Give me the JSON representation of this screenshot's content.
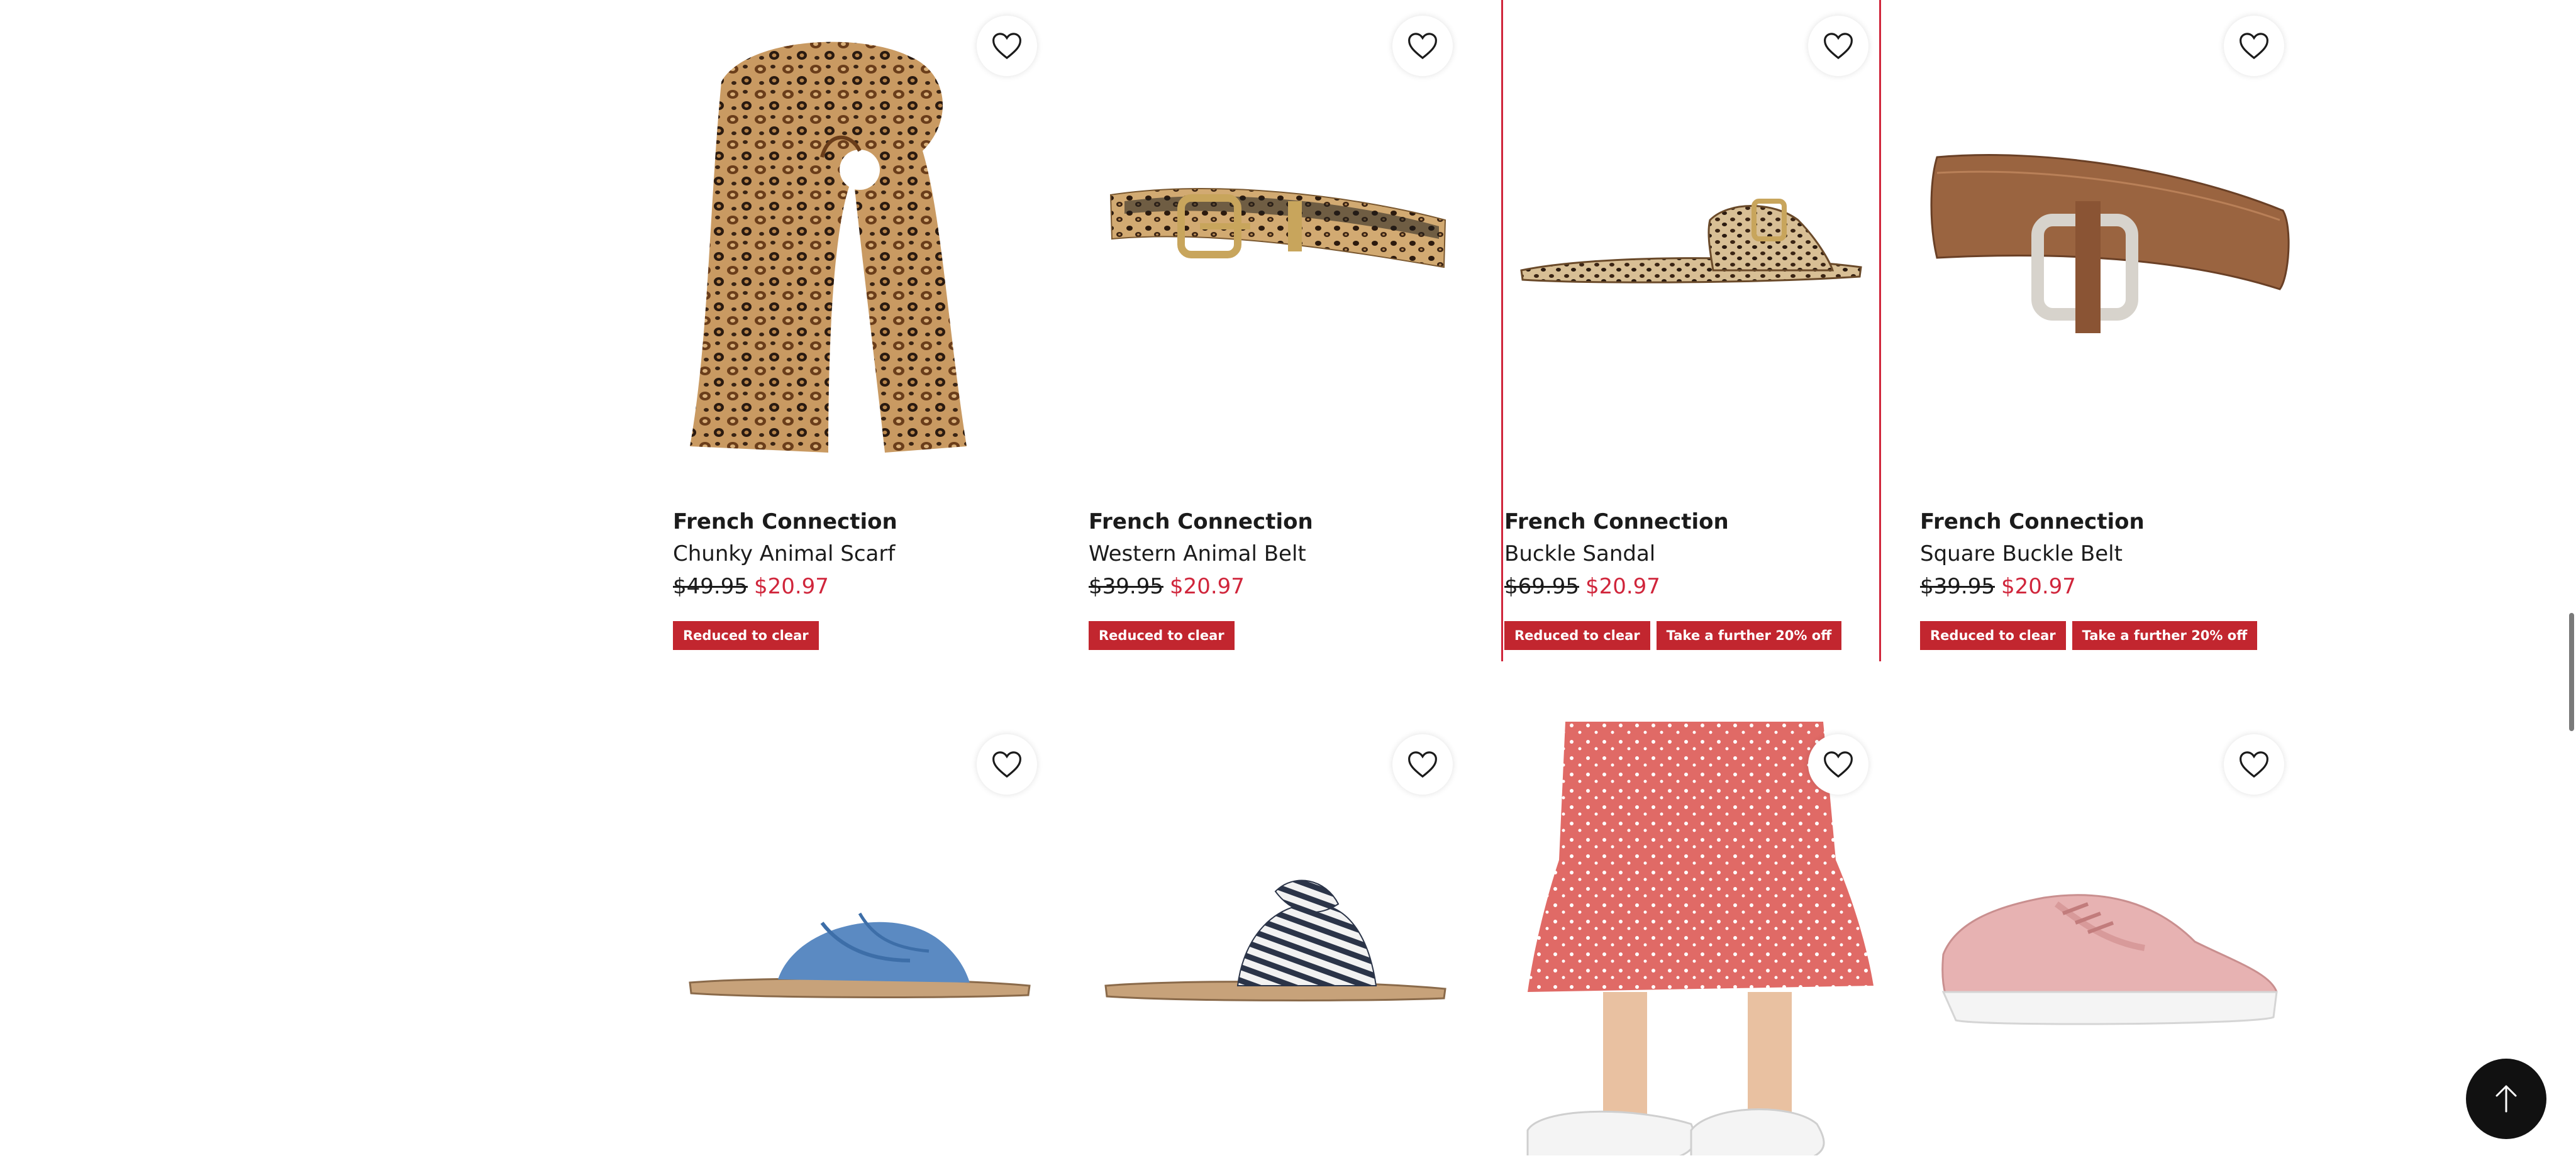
{
  "accent_color": "#d0253b",
  "badge_color": "#c2262f",
  "favorite_icon": "heart-outline-icon",
  "back_to_top_icon": "arrow-up-icon",
  "products": [
    {
      "brand": "French Connection",
      "name": "Chunky Animal Scarf",
      "was_price": "$49.95",
      "now_price": "$20.97",
      "badges": [
        "Reduced to clear"
      ],
      "image": "leopard-print-scarf"
    },
    {
      "brand": "French Connection",
      "name": "Western Animal Belt",
      "was_price": "$39.95",
      "now_price": "$20.97",
      "badges": [
        "Reduced to clear"
      ],
      "image": "leopard-print-belt"
    },
    {
      "brand": "French Connection",
      "name": "Buckle Sandal",
      "was_price": "$69.95",
      "now_price": "$20.97",
      "badges": [
        "Reduced to clear",
        "Take a further 20% off"
      ],
      "image": "leopard-buckle-sandal"
    },
    {
      "brand": "French Connection",
      "name": "Square Buckle Belt",
      "was_price": "$39.95",
      "now_price": "$20.97",
      "badges": [
        "Reduced to clear",
        "Take a further 20% off"
      ],
      "image": "brown-square-buckle-belt"
    }
  ],
  "next_row_images": [
    "denim-knot-slide",
    "striped-bow-slide",
    "red-floral-dress-with-sneakers",
    "pink-sneaker"
  ]
}
